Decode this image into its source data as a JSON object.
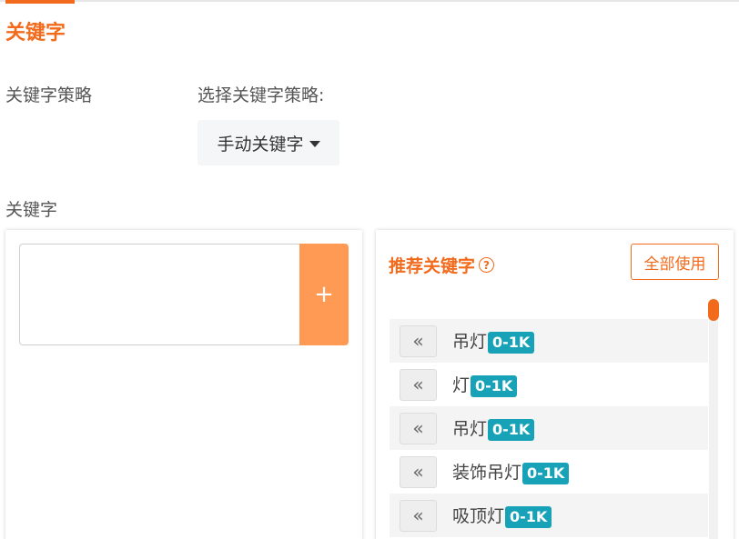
{
  "tab": {
    "title": "关键字"
  },
  "strategy": {
    "label": "关键字策略",
    "select_label": "选择关键字策略:",
    "selected": "手动关键字"
  },
  "keywords": {
    "label": "关键字",
    "input_value": "",
    "add_button": "+"
  },
  "recommended": {
    "title": "推荐关键字",
    "help_icon": "?",
    "use_all_button": "全部使用",
    "use_icon": "«",
    "items": [
      {
        "keyword": "吊灯",
        "volume": "0-1K"
      },
      {
        "keyword": "灯",
        "volume": "0-1K"
      },
      {
        "keyword": "吊灯",
        "volume": "0-1K"
      },
      {
        "keyword": "装饰吊灯",
        "volume": "0-1K"
      },
      {
        "keyword": "吸顶灯",
        "volume": "0-1K"
      }
    ]
  },
  "colors": {
    "accent": "#f26b1d",
    "add_button": "#ff9a55",
    "badge": "#17a2b8"
  }
}
